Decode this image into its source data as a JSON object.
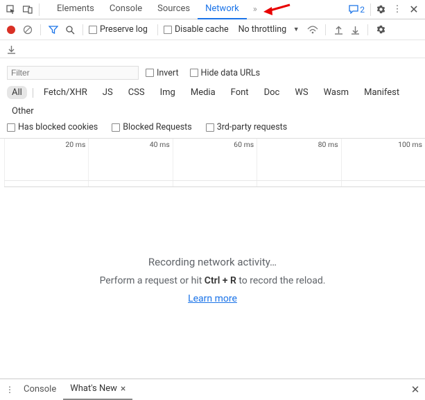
{
  "tabs": {
    "elements": "Elements",
    "console": "Console",
    "sources": "Sources",
    "network": "Network"
  },
  "feedbackCount": "2",
  "toolbar": {
    "preserveLog": "Preserve log",
    "disableCache": "Disable cache",
    "throttling": "No throttling"
  },
  "filter": {
    "placeholder": "Filter",
    "invert": "Invert",
    "hideDataUrls": "Hide data URLs"
  },
  "types": {
    "all": "All",
    "fetch": "Fetch/XHR",
    "js": "JS",
    "css": "CSS",
    "img": "Img",
    "media": "Media",
    "font": "Font",
    "doc": "Doc",
    "ws": "WS",
    "wasm": "Wasm",
    "manifest": "Manifest",
    "other": "Other"
  },
  "checks": {
    "blockedCookies": "Has blocked cookies",
    "blockedRequests": "Blocked Requests",
    "thirdParty": "3rd-party requests"
  },
  "timeline": {
    "t1": "20 ms",
    "t2": "40 ms",
    "t3": "60 ms",
    "t4": "80 ms",
    "t5": "100 ms"
  },
  "empty": {
    "title": "Recording network activity…",
    "subPrefix": "Perform a request or hit ",
    "shortcut": "Ctrl + R",
    "subSuffix": " to record the reload.",
    "link": "Learn more"
  },
  "drawer": {
    "console": "Console",
    "whatsNew": "What's New"
  }
}
